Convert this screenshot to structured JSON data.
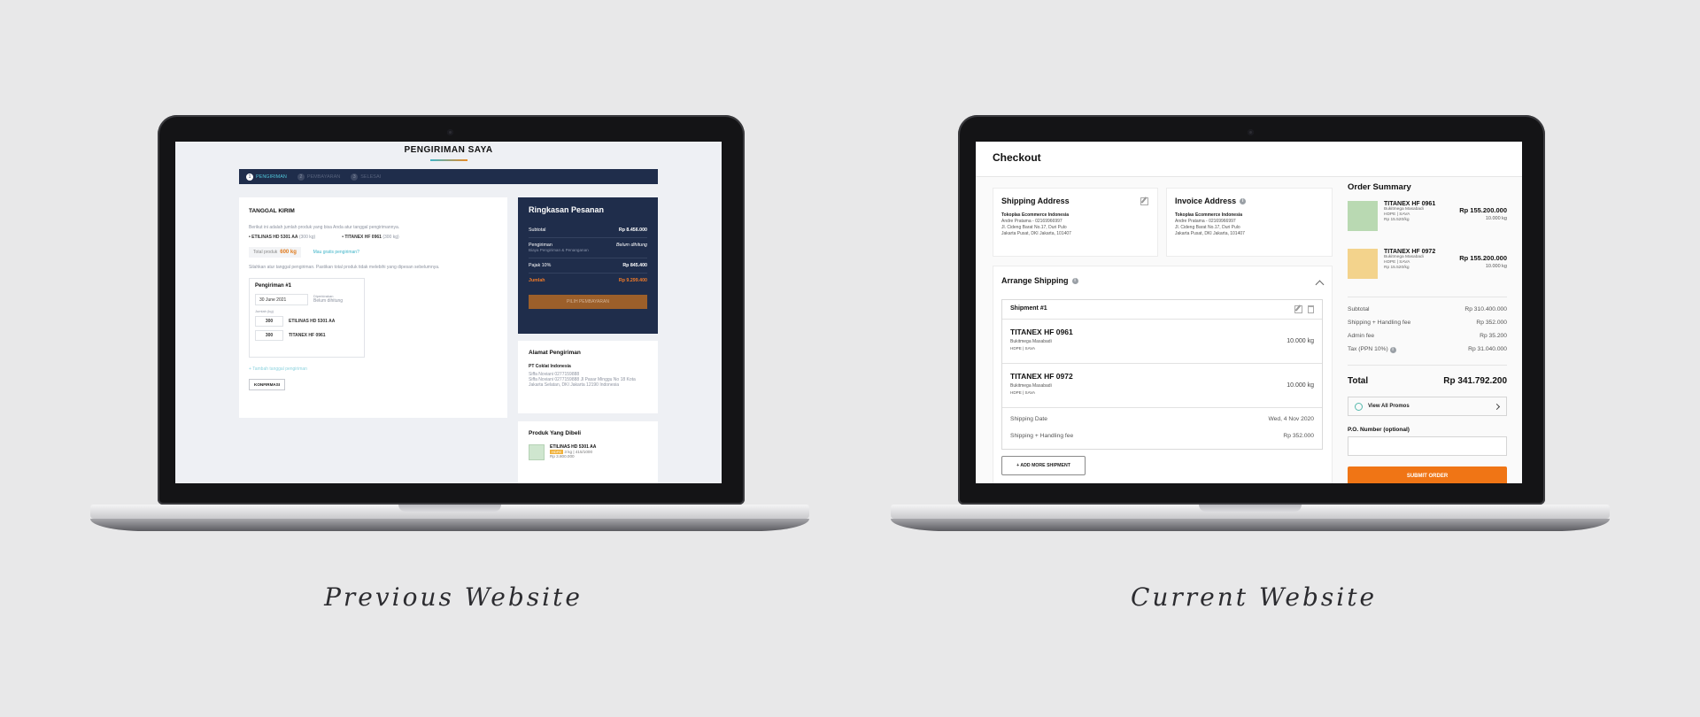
{
  "captions": {
    "previous": "Previous Website",
    "current": "Current Website"
  },
  "previous": {
    "title": "PENGIRIMAN SAYA",
    "steps": [
      {
        "num": "1",
        "label": "PENGIRIMAN"
      },
      {
        "num": "2",
        "label": "PEMBAYARAN"
      },
      {
        "num": "3",
        "label": "SELESAI"
      }
    ],
    "main": {
      "heading": "TANGGAL KIRIM",
      "intro": "Berikut ini adalah jumlah produk yang bisa Anda atur tanggal pengirimannya.",
      "product_a": "• ETILINAS HD 5301 AA",
      "product_a_qty": "(300 kg)",
      "product_b": "• TITANEX HF 0961",
      "product_b_qty": "(300 kg)",
      "total_label": "Total produk",
      "total_value": "600 kg",
      "help_link": "Mau gratis pengiriman?",
      "instruction": "Silahkan atur tanggal pengiriman. Pastikan total produk tidak melebihi yang dipesan sebelumnya.",
      "shipment_title": "Pengiriman #1",
      "date_value": "30 June 2021",
      "estimate_label": "Diperkirakan",
      "estimate_value": "Belum dihitung",
      "quantity_label": "Jumlah (kg)",
      "line1_qty": "300",
      "line1_name": "ETILINAS HD 5301 AA",
      "line2_qty": "300",
      "line2_name": "TITANEX HF 0961",
      "add_link": "+ Tambah tanggal pengiriman",
      "confirm_button": "KONFIRMASI"
    },
    "summary": {
      "title": "Ringkasan Pesanan",
      "subtotal_label": "Subtotal",
      "subtotal_value": "Rp 8.456.000",
      "shipping_label": "Pengiriman",
      "shipping_sub": "Biaya Pengiriman & Penanganan",
      "shipping_value": "Belum dihitung",
      "tax_label": "Pajak 10%",
      "tax_value": "Rp 845.400",
      "total_label": "Jumlah",
      "total_value": "Rp 9.299.400",
      "pay_button": "PILIH PEMBAYARAN"
    },
    "address": {
      "title": "Alamat Pengiriman",
      "company": "PT Coklat Indonesia",
      "line1": "Siffa Noviani 0277159888",
      "line2": "Siffa Noviani 0277159888 Jl Pasar Minggu No 18 Kota Jakarta Selatan, DKI Jakarta 12190 Indonesia"
    },
    "products": {
      "title": "Produk Yang Dibeli",
      "name": "ETILINAS HD 5301 AA",
      "tag": "HDPE",
      "meta": "3 kg  |  415/1000",
      "price": "Rp 3.800.000"
    }
  },
  "current": {
    "page_title": "Checkout",
    "shipping_address": {
      "title": "Shipping Address",
      "company": "Tokoplas Ecommerce Indonesia",
      "contact": "Andre Pratama - 02169966997",
      "street": "Jl. Cideng Barat No.17, Duri Pulo",
      "city": "Jakarta Pusat, DKI Jakarta, 101407"
    },
    "invoice_address": {
      "title": "Invoice Address",
      "company": "Tokoplas Ecommerce Indonesia",
      "contact": "Andre Pratama - 02169966997",
      "street": "Jl. Cideng Barat No.17, Duri Pulo",
      "city": "Jakarta Pusat, DKI Jakarta, 101407"
    },
    "arrange": {
      "title": "Arrange Shipping",
      "shipment_title": "Shipment #1",
      "items": [
        {
          "name": "TITANEX HF 0961",
          "supplier": "Bukitmega Masabadi",
          "meta": "HDPE | SAVA",
          "weight": "10.000 kg"
        },
        {
          "name": "TITANEX HF 0972",
          "supplier": "Bukitmega Masabadi",
          "meta": "HDPE | SAVA",
          "weight": "10.000 kg"
        }
      ],
      "date_label": "Shipping Date",
      "date_value": "Wed, 4 Nov 2020",
      "fee_label": "Shipping + Handling fee",
      "fee_value": "Rp 352.000",
      "add_button": "+ ADD MORE SHIPMENT"
    },
    "summary": {
      "title": "Order Summary",
      "items": [
        {
          "name": "TITANEX HF 0961",
          "supplier": "Bukitmega Masabadi",
          "meta": "HDPE | SAVA",
          "unit": "Rp 15.520/kg",
          "price": "Rp 155.200.000",
          "qty": "10.000 kg",
          "thumb_color": "#b9d9b2"
        },
        {
          "name": "TITANEX HF 0972",
          "supplier": "Bukitmega Masabadi",
          "meta": "HDPE | SAVA",
          "unit": "Rp 15.520/kg",
          "price": "Rp 155.200.000",
          "qty": "10.000 kg",
          "thumb_color": "#f3d38c"
        }
      ],
      "rows": [
        {
          "label": "Subtotal",
          "value": "Rp 310.400.000"
        },
        {
          "label": "Shipping + Handling fee",
          "value": "Rp 352.000"
        },
        {
          "label": "Admin fee",
          "value": "Rp 35.200"
        },
        {
          "label": "Tax (PPN 10%)",
          "value": "Rp 31.040.000"
        }
      ],
      "total_label": "Total",
      "total_value": "Rp 341.792.200",
      "promo_label": "View All Promos",
      "po_label": "P.O. Number (optional)",
      "submit_button": "SUBMIT ORDER"
    }
  }
}
